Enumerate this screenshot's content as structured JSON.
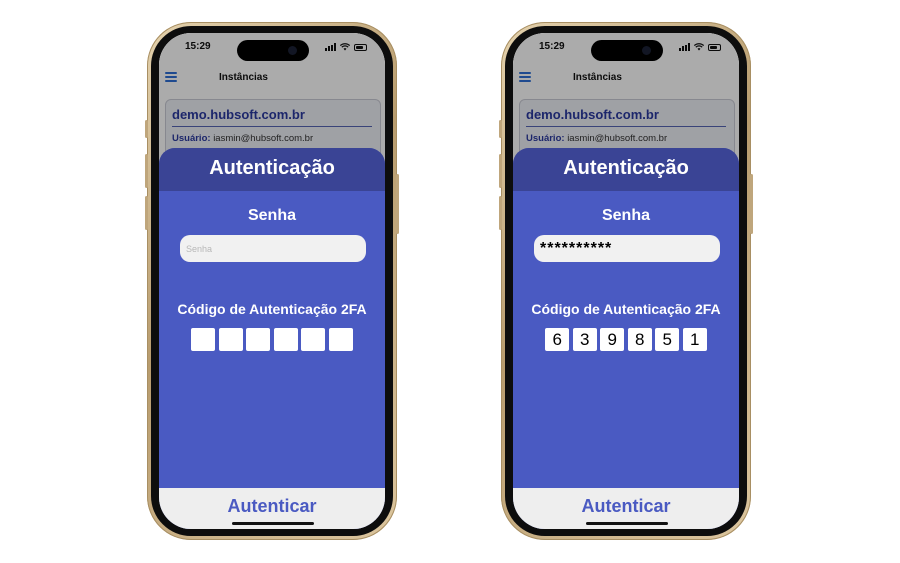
{
  "screens": [
    {
      "status_time": "15:29",
      "nav_title": "Instâncias",
      "instance_host": "demo.hubsoft.com.br",
      "user_label": "Usuário:",
      "user_value": "iasmin@hubsoft.com.br",
      "modal_title": "Autenticação",
      "password_label": "Senha",
      "password_placeholder": "Senha",
      "password_value": "",
      "twofa_label": "Código de Autenticação 2FA",
      "code_digits": [
        "",
        "",
        "",
        "",
        "",
        ""
      ],
      "auth_button": "Autenticar"
    },
    {
      "status_time": "15:29",
      "nav_title": "Instâncias",
      "instance_host": "demo.hubsoft.com.br",
      "user_label": "Usuário:",
      "user_value": "iasmin@hubsoft.com.br",
      "modal_title": "Autenticação",
      "password_label": "Senha",
      "password_placeholder": "Senha",
      "password_value": "**********",
      "twofa_label": "Código de Autenticação 2FA",
      "code_digits": [
        "6",
        "3",
        "9",
        "8",
        "5",
        "1"
      ],
      "auth_button": "Autenticar"
    }
  ],
  "icons": {
    "menu": "hamburger-menu-icon",
    "signal": "cellular-signal-icon",
    "wifi": "wifi-icon",
    "battery": "battery-icon"
  },
  "colors": {
    "modal_bg": "#4a5ac2",
    "modal_header": "#3a4495",
    "accent_text": "#2b3aa0",
    "button_text": "#4a5ac2",
    "footer_bg": "#eeeeee"
  }
}
